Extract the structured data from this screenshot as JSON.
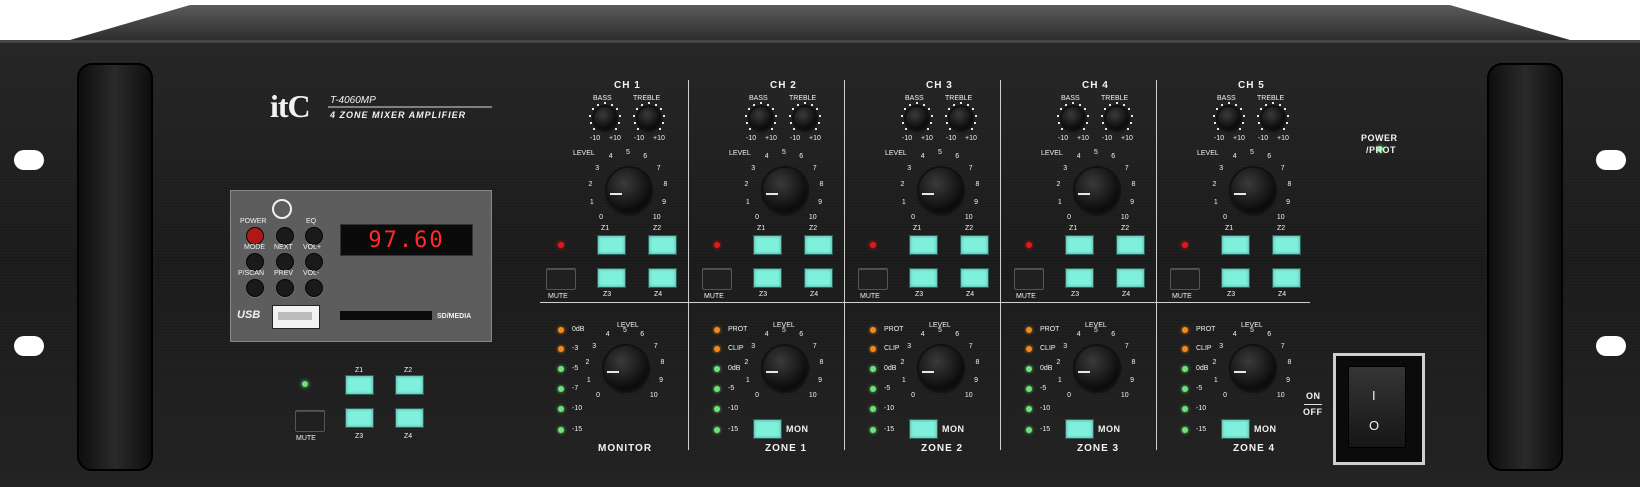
{
  "brand": {
    "logo": "itC",
    "model": "T-4060MP",
    "subtitle": "4 ZONE MIXER AMPLIFIER"
  },
  "media_player": {
    "display": "97.60",
    "buttons": [
      "POWER",
      "MODE",
      "P/SCAN",
      "NEXT",
      "PREV",
      "EQ",
      "VOL+",
      "VOL-"
    ],
    "usb_label": "USB",
    "sd_label": "SD/MEDIA"
  },
  "paging": {
    "z_labels": [
      "Z1",
      "Z2",
      "Z3",
      "Z4"
    ],
    "mute_label": "MUTE"
  },
  "channels": [
    {
      "name": "CH 1"
    },
    {
      "name": "CH 2"
    },
    {
      "name": "CH 3"
    },
    {
      "name": "CH 4"
    },
    {
      "name": "CH 5"
    }
  ],
  "channel_controls": {
    "bass": "BASS",
    "treble": "TREBLE",
    "minus": "-10",
    "plus": "+10",
    "level": "LEVEL",
    "scale": [
      "0",
      "1",
      "2",
      "3",
      "4",
      "5",
      "6",
      "7",
      "8",
      "9",
      "10"
    ],
    "z_labels": [
      "Z1",
      "Z2",
      "Z3",
      "Z4"
    ],
    "mute": "MUTE"
  },
  "monitor": {
    "name": "MONITOR",
    "level": "LEVEL",
    "meter": [
      "0dB",
      "-3",
      "-5",
      "-7",
      "-10",
      "-15"
    ]
  },
  "zones": [
    {
      "name": "ZONE 1"
    },
    {
      "name": "ZONE 2"
    },
    {
      "name": "ZONE 3"
    },
    {
      "name": "ZONE 4"
    }
  ],
  "zone_controls": {
    "level": "LEVEL",
    "meter": [
      "PROT",
      "CLIP",
      "0dB",
      "-5",
      "-10",
      "-15"
    ],
    "mon": "MON"
  },
  "power": {
    "led_label_1": "POWER",
    "led_label_2": "/PROT",
    "on": "ON",
    "off": "OFF",
    "on_symbol": "I",
    "off_symbol": "O"
  },
  "colors": {
    "accent_cyan": "#7ef0dc",
    "led_green": "#6de27a",
    "led_orange": "#f08a1e",
    "led_red": "#e01818",
    "display_red": "#ff2a2a",
    "panel": "#1b1b1b"
  }
}
